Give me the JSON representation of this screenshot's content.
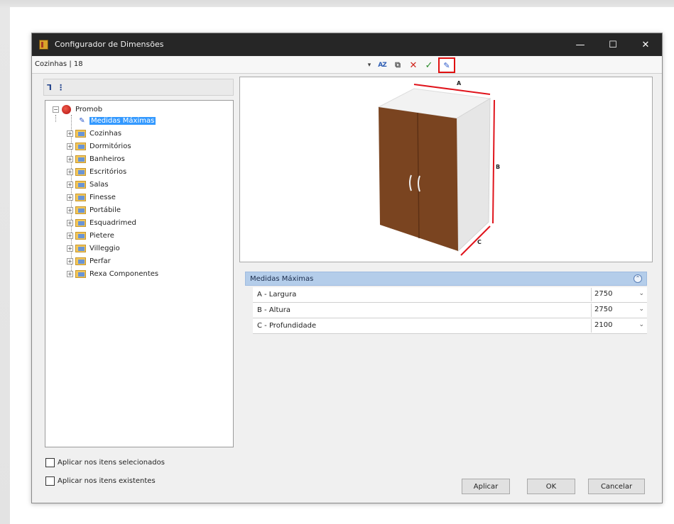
{
  "window": {
    "title": "Configurador de Dimensões",
    "minimize": "—",
    "maximize": "☐",
    "close": "✕"
  },
  "address": {
    "path": "Cozinhas | 18"
  },
  "toolbar": {
    "dropdown_glyph": "▾",
    "sort_glyph": "AZ",
    "copy_glyph": "⧉",
    "delete_glyph": "✕",
    "apply_glyph": "✓",
    "edit_glyph": "✎"
  },
  "tree": {
    "tools": {
      "expand_glyph": "⅂",
      "collapse_glyph": "⋮"
    },
    "root": {
      "label": "Promob"
    },
    "selected": {
      "label": "Medidas Máximas"
    },
    "items": [
      {
        "label": "Cozinhas"
      },
      {
        "label": "Dormitórios"
      },
      {
        "label": "Banheiros"
      },
      {
        "label": "Escritórios"
      },
      {
        "label": "Salas"
      },
      {
        "label": "Finesse"
      },
      {
        "label": "Portábile"
      },
      {
        "label": "Esquadrimed"
      },
      {
        "label": "Pietere"
      },
      {
        "label": "Villeggio"
      },
      {
        "label": "Perfar"
      },
      {
        "label": "Rexa Componentes"
      }
    ]
  },
  "preview": {
    "dim_a": "A",
    "dim_b": "B",
    "dim_c": "C",
    "colors": {
      "door": "#7a4420",
      "carcass": "#f2f2f2",
      "dimension": "#e0141c"
    }
  },
  "properties": {
    "title": "Medidas Máximas",
    "collapse_glyph": "⌃",
    "rows": [
      {
        "label": "A - Largura",
        "value": "2750"
      },
      {
        "label": "B - Altura",
        "value": "2750"
      },
      {
        "label": "C - Profundidade",
        "value": "2100"
      }
    ],
    "chevron": "⌄"
  },
  "options": {
    "apply_selected": "Aplicar nos itens selecionados",
    "apply_existing": "Aplicar nos itens existentes"
  },
  "buttons": {
    "apply": "Aplicar",
    "ok": "OK",
    "cancel": "Cancelar"
  }
}
